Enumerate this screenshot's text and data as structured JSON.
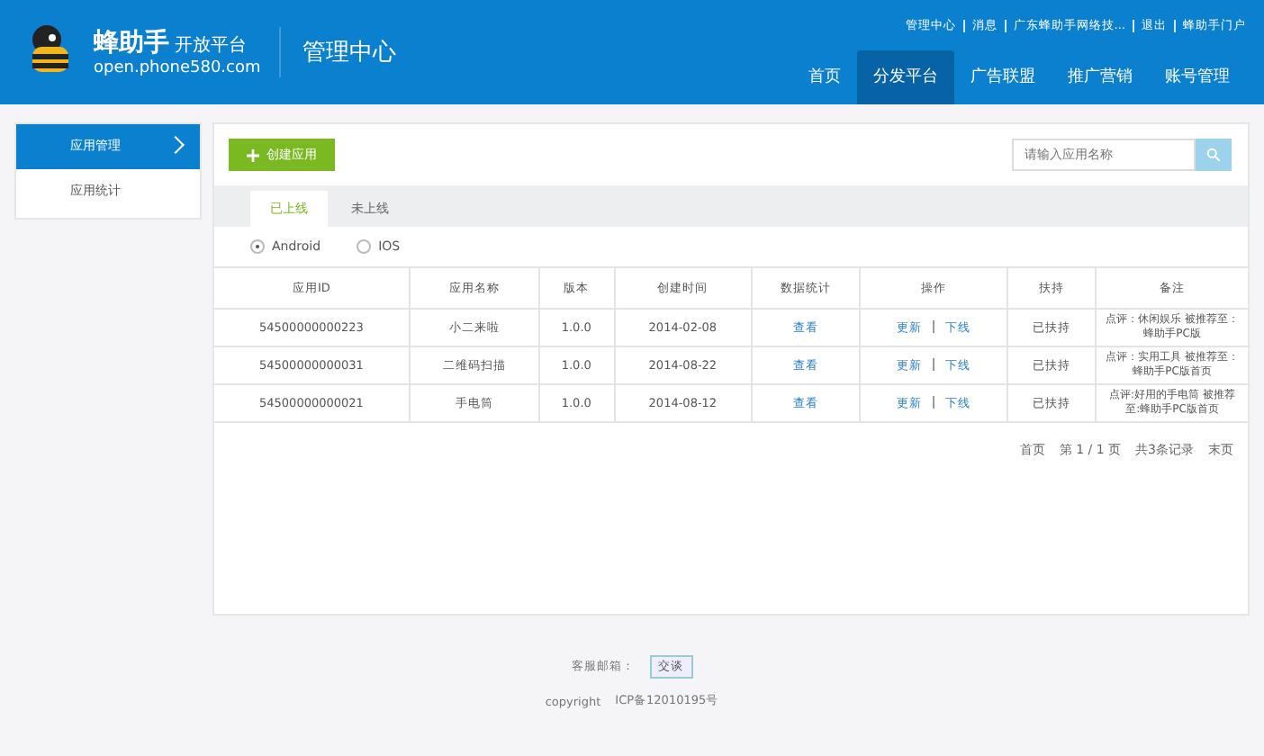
{
  "header": {
    "brand": "蜂助手",
    "brand_sub": "开放平台",
    "domain": "open.phone580.com",
    "section_title": "管理中心",
    "top_links": [
      "管理中心",
      "消息",
      "广东蜂助手网络技...",
      "退出",
      "蜂助手门户"
    ],
    "nav": [
      {
        "label": "首页",
        "selected": false
      },
      {
        "label": "分发平台",
        "selected": true
      },
      {
        "label": "广告联盟",
        "selected": false
      },
      {
        "label": "推广营销",
        "selected": false
      },
      {
        "label": "账号管理",
        "selected": false
      }
    ]
  },
  "sidebar": {
    "items": [
      {
        "label": "应用管理",
        "selected": true
      },
      {
        "label": "应用统计",
        "selected": false
      }
    ]
  },
  "toolbar": {
    "create_button": "创建应用",
    "search": {
      "placeholder": "请输入应用名称"
    }
  },
  "tabs": [
    {
      "label": "已上线",
      "selected": true
    },
    {
      "label": "未上线",
      "selected": false
    }
  ],
  "platforms": [
    {
      "label": "Android",
      "selected": true
    },
    {
      "label": "IOS",
      "selected": false
    }
  ],
  "table": {
    "columns": [
      "应用ID",
      "应用名称",
      "版本",
      "创建时间",
      "数据统计",
      "操作",
      "扶持",
      "备注"
    ],
    "rows": [
      {
        "id": "54500000000223",
        "name": "小二来啦",
        "version": "1.0.0",
        "created": "2014-02-08",
        "stats": "查看",
        "actions": [
          "更新",
          "下线"
        ],
        "support": "已扶持",
        "note": "点评：休闲娱乐 被推荐至：蜂助手PC版"
      },
      {
        "id": "54500000000031",
        "name": "二维码扫描",
        "version": "1.0.0",
        "created": "2014-08-22",
        "stats": "查看",
        "actions": [
          "更新",
          "下线"
        ],
        "support": "已扶持",
        "note": "点评：实用工具 被推荐至：蜂助手PC版首页"
      },
      {
        "id": "54500000000021",
        "name": "手电筒",
        "version": "1.0.0",
        "created": "2014-08-12",
        "stats": "查看",
        "actions": [
          "更新",
          "下线"
        ],
        "support": "已扶持",
        "note": "点评:好用的手电筒 被推荐至:蜂助手PC版首页"
      }
    ]
  },
  "pagination": [
    "首页",
    "第 1 / 1 页",
    "共3条记录",
    "末页"
  ],
  "footer": {
    "lines": [
      "客服邮箱：",
      "copyright"
    ],
    "chat_button": "交谈",
    "icp": "ICP备12010195号"
  }
}
